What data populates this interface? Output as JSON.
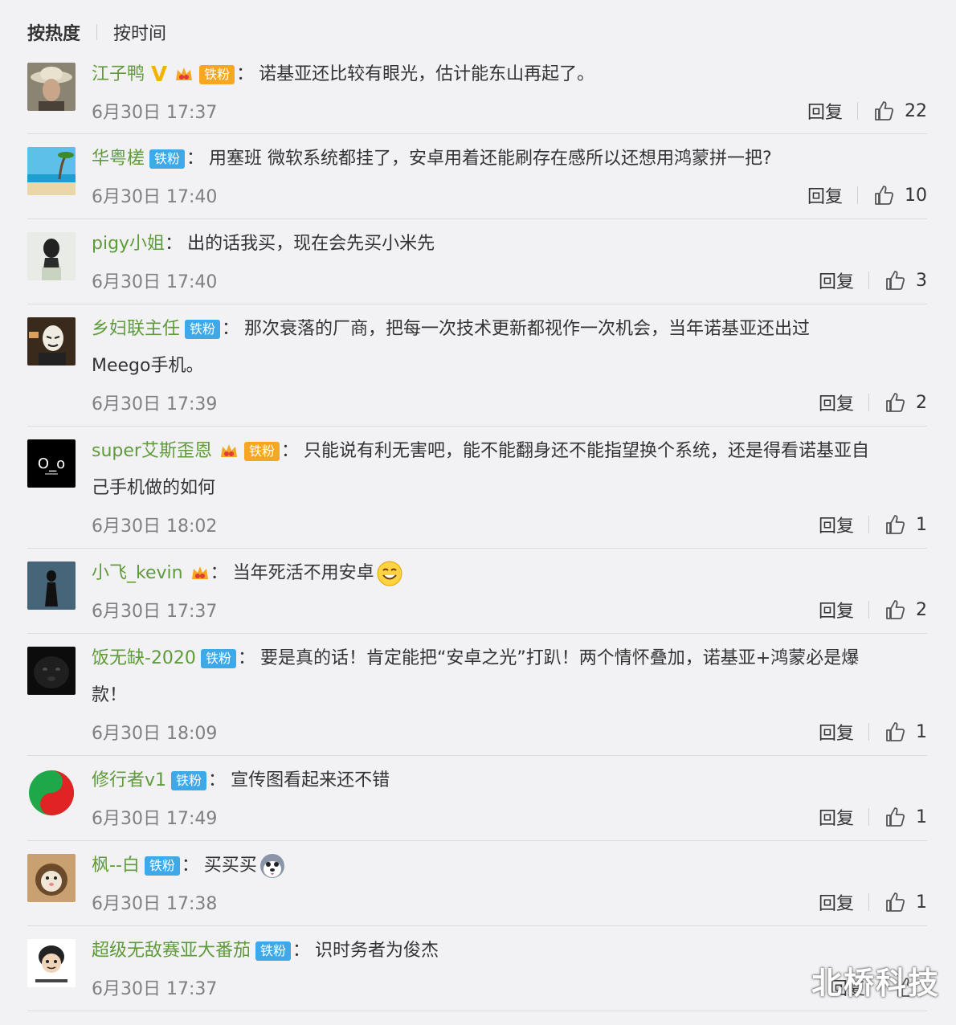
{
  "sort": {
    "hot": "按热度",
    "time": "按时间"
  },
  "reply_label": "回复",
  "colon": "：",
  "badge_label": "铁粉",
  "comments": [
    {
      "name": "江子鸭",
      "text": "诺基亚还比较有眼光，估计能东山再起了。",
      "text2": "",
      "time": "6月30日 17:37",
      "likes": "22",
      "vip": "V"
    },
    {
      "name": "华粤槎",
      "text": "用塞班 微软系统都挂了，安卓用着还能刷存在感所以还想用鸿蒙拼一把?",
      "text2": "",
      "time": "6月30日 17:40",
      "likes": "10"
    },
    {
      "name": "pigy小姐",
      "text": "出的话我买，现在会先买小米先",
      "text2": "",
      "time": "6月30日 17:40",
      "likes": "3"
    },
    {
      "name": "乡妇联主任",
      "text": "那次衰落的厂商，把每一次技术更新都视作一次机会，当年诺基亚还出过",
      "text2": "Meego手机。",
      "time": "6月30日 17:39",
      "likes": "2"
    },
    {
      "name": "super艾斯歪恩",
      "text": "只能说有利无害吧，能不能翻身还不能指望换个系统，还是得看诺基亚自",
      "text2": "己手机做的如何",
      "time": "6月30日 18:02",
      "likes": "1"
    },
    {
      "name": "小飞_kevin",
      "text": "当年死活不用安卓",
      "text2": "",
      "time": "6月30日 17:37",
      "likes": "2"
    },
    {
      "name": "饭无缺-2020",
      "text": "要是真的话！肯定能把“安卓之光”打趴！两个情怀叠加，诺基亚+鸿蒙必是爆",
      "text2": "款！",
      "time": "6月30日 18:09",
      "likes": "1"
    },
    {
      "name": "修行者v1",
      "text": "宣传图看起来还不错",
      "text2": "",
      "time": "6月30日 17:49",
      "likes": "1"
    },
    {
      "name": "枫--白",
      "text": "买买买",
      "text2": "",
      "time": "6月30日 17:38",
      "likes": "1"
    },
    {
      "name": "超级无敌赛亚大番茄",
      "text": "识时务者为俊杰",
      "text2": "",
      "time": "6月30日 17:37",
      "likes": ""
    }
  ],
  "watermark": "北桥科技",
  "colors": {
    "name": "#5f9b3a",
    "badge": "#3da9e8",
    "background": "#f2f2f5"
  }
}
